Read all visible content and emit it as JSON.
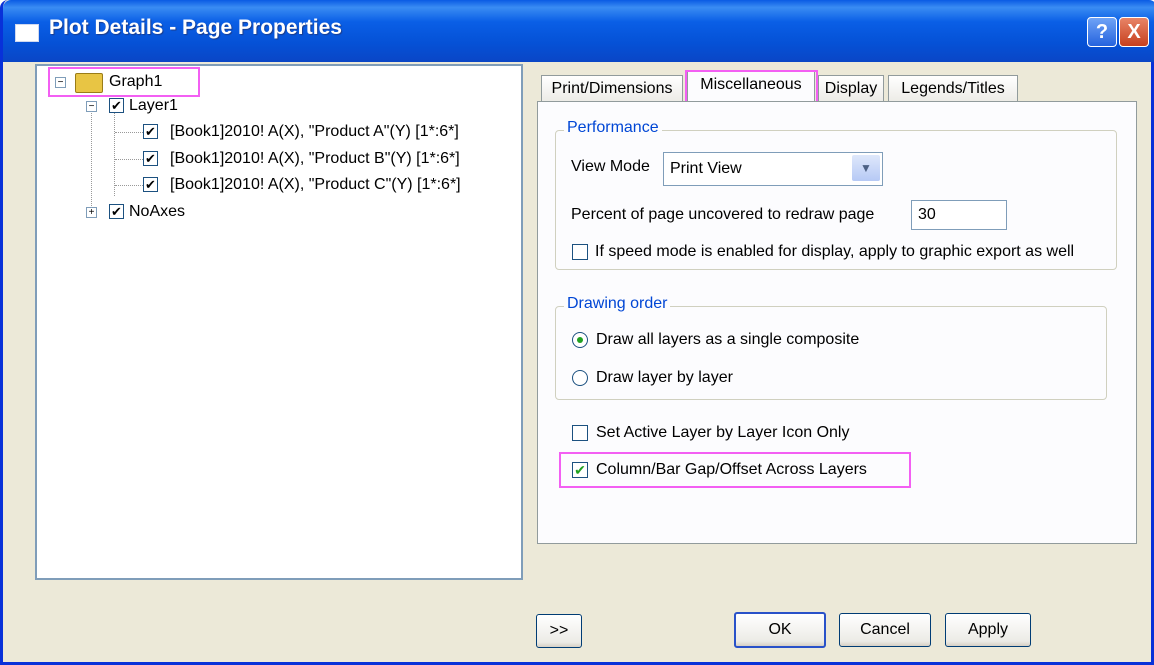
{
  "window": {
    "title": "Plot Details - Page Properties",
    "help_label": "?",
    "close_label": "X"
  },
  "tree": {
    "root": "Graph1",
    "layer": "Layer1",
    "items": [
      "[Book1]2010! A(X), \"Product A\"(Y) [1*:6*]",
      "[Book1]2010! A(X), \"Product B\"(Y) [1*:6*]",
      "[Book1]2010! A(X), \"Product C\"(Y) [1*:6*]"
    ],
    "noaxes": "NoAxes"
  },
  "tabs": [
    "Print/Dimensions",
    "Miscellaneous",
    "Display",
    "Legends/Titles"
  ],
  "active_tab": "Miscellaneous",
  "performance": {
    "title": "Performance",
    "view_mode_label": "View Mode",
    "view_mode_value": "Print View",
    "percent_label": "Percent of page uncovered to redraw page",
    "percent_value": "30",
    "speed_mode_label": "If speed mode is enabled for display, apply to graphic export as well",
    "speed_mode_checked": false
  },
  "drawing_order": {
    "title": "Drawing order",
    "option1": "Draw all layers as a single composite",
    "option2": "Draw layer by layer",
    "selected": "option1"
  },
  "set_active_layer": {
    "label": "Set Active Layer by Layer Icon Only",
    "checked": false
  },
  "column_bar_gap": {
    "label": "Column/Bar Gap/Offset Across Layers",
    "checked": true
  },
  "buttons": {
    "expand": ">>",
    "ok": "OK",
    "cancel": "Cancel",
    "apply": "Apply"
  },
  "colors": {
    "highlight": "#f35ff3",
    "titlebar": "#0a5fe6",
    "group_title": "#0046d5",
    "check": "#21a121"
  }
}
